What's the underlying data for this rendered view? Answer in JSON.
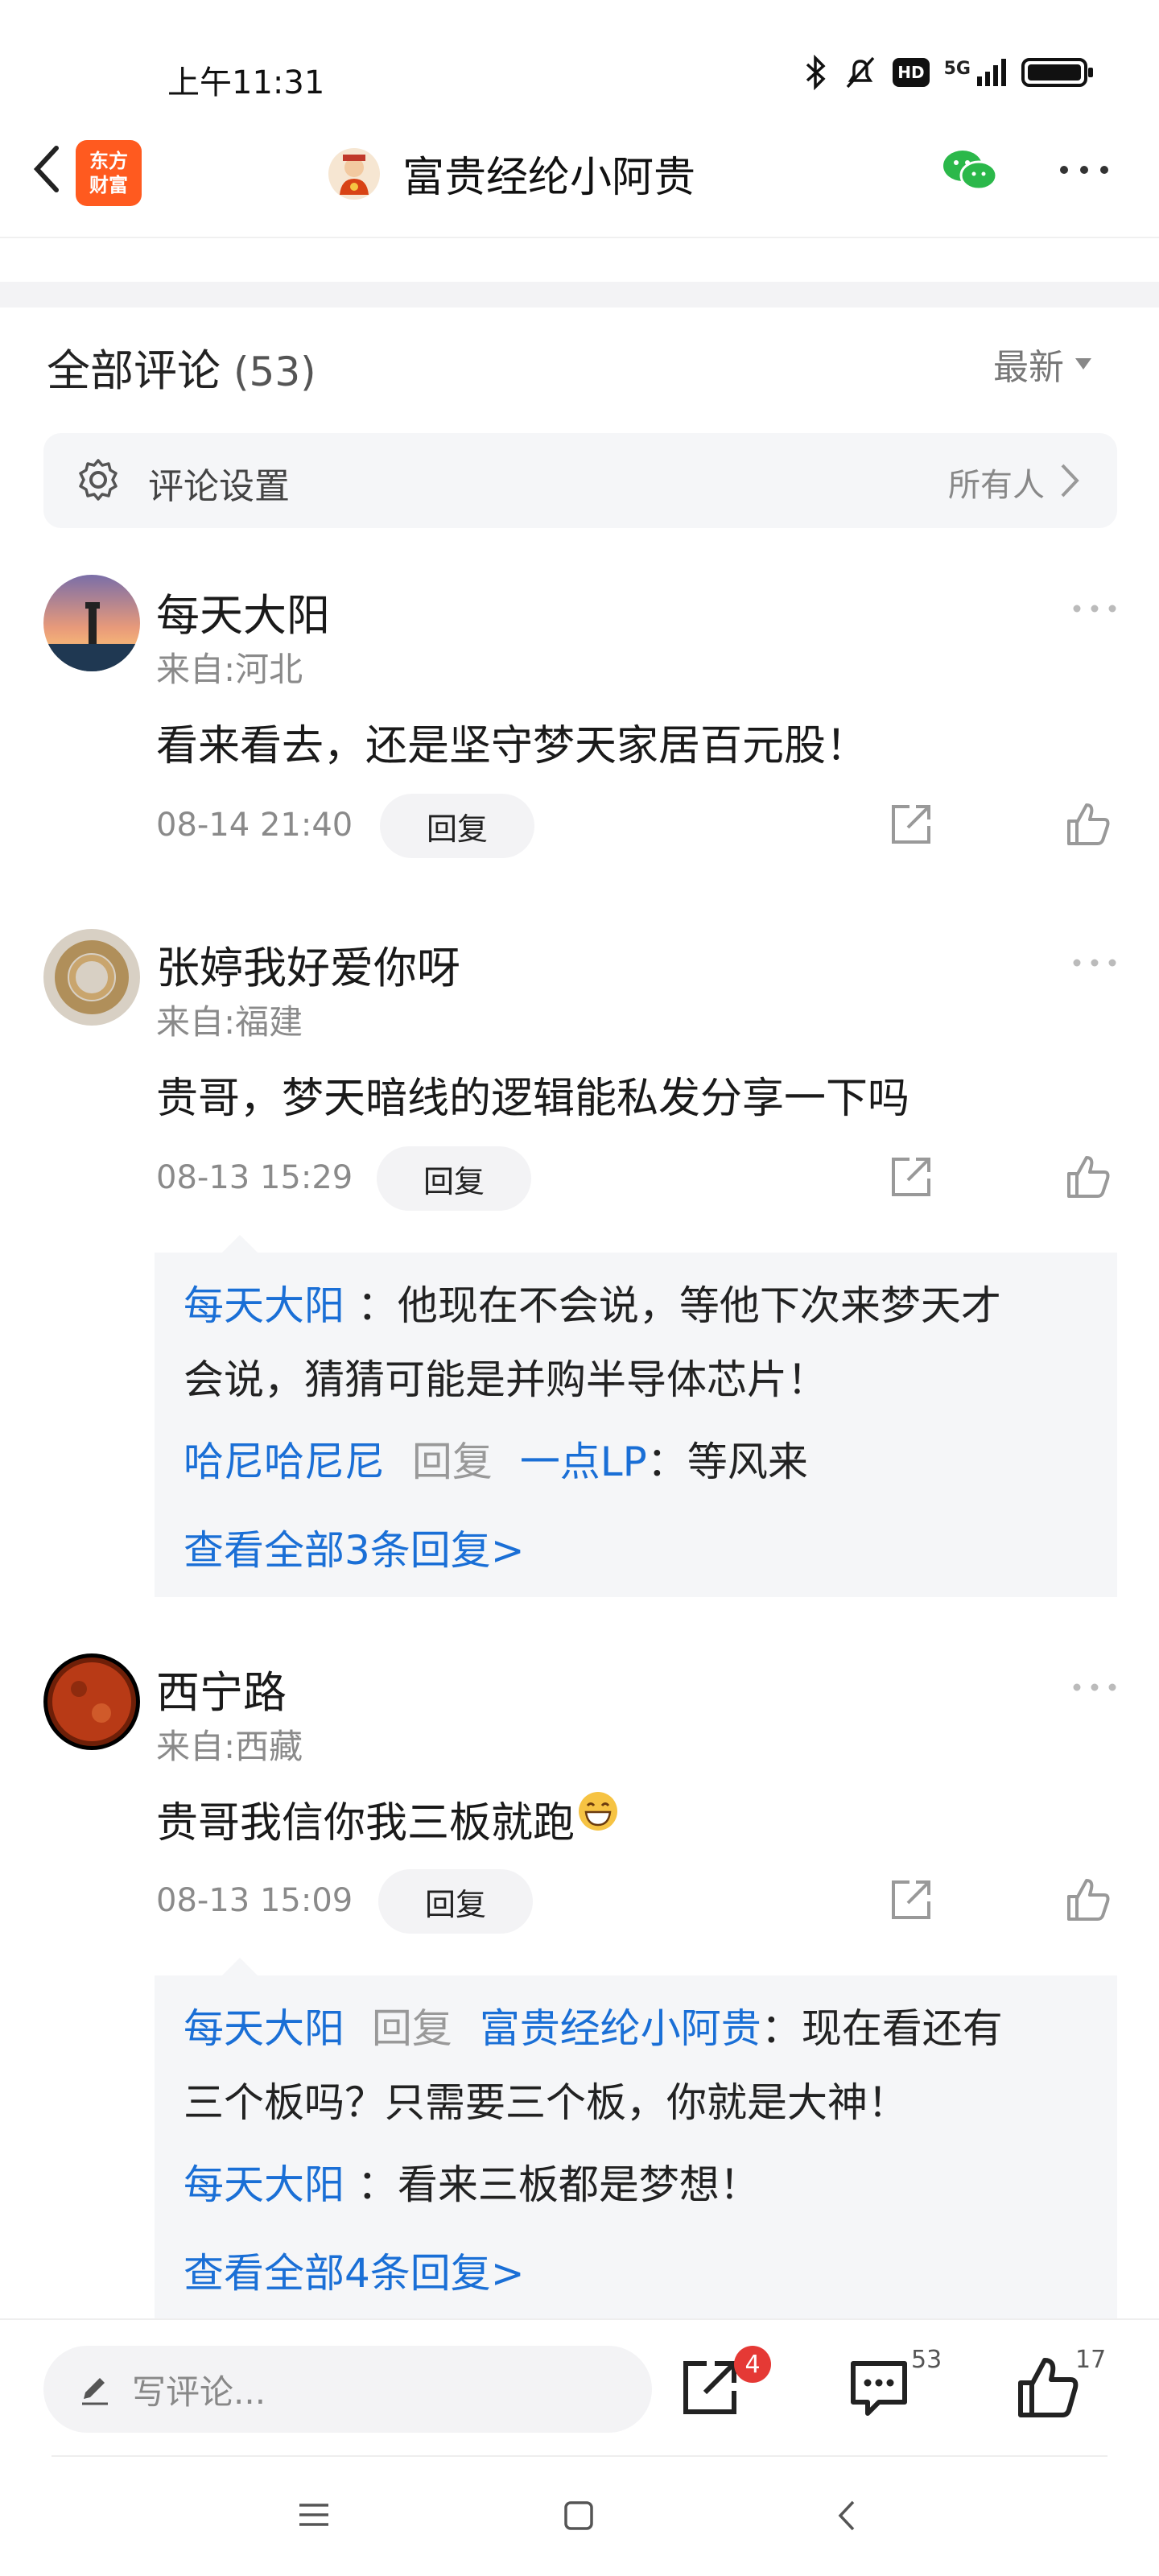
{
  "status": {
    "time": "上午11:31",
    "network": "5G",
    "hd": "HD"
  },
  "nav": {
    "brand_line1": "东方",
    "brand_line2": "财富",
    "title": "富贵经纶小阿贵"
  },
  "comments_header": {
    "title": "全部评论",
    "count": "(53)",
    "sort": "最新"
  },
  "settings": {
    "label": "评论设置",
    "value": "所有人"
  },
  "comments": [
    {
      "name": "每天大阳",
      "location": "来自:河北",
      "text": "看来看去，还是坚守梦天家居百元股！",
      "time": "08-14 21:40",
      "reply_label": "回复"
    },
    {
      "name": "张婷我好爱你呀",
      "location": "来自:福建",
      "text": "贵哥，梦天暗线的逻辑能私发分享一下吗",
      "time": "08-13 15:29",
      "reply_label": "回复",
      "replies": [
        {
          "author": "每天大阳",
          "text_line1": "：他现在不会说，等他下次来梦天才",
          "text_line2": "会说，猜猜可能是并购半导体芯片！"
        },
        {
          "author": "哈尼哈尼尼",
          "verb": "回复",
          "target": "一点LP",
          "text": "：等风来"
        }
      ],
      "more": "查看全部3条回复>"
    },
    {
      "name": "西宁路",
      "location": "来自:西藏",
      "text": "贵哥我信你我三板就跑",
      "time": "08-13 15:09",
      "reply_label": "回复",
      "replies": [
        {
          "author": "每天大阳",
          "verb": "回复",
          "target": "富贵经纶小阿贵",
          "text_line1": "：现在看还有",
          "text_line2": "三个板吗？只需要三个板，你就是大神！"
        },
        {
          "author": "每天大阳",
          "text": "：看来三板都是梦想！"
        }
      ],
      "more": "查看全部4条回复>"
    }
  ],
  "bottom": {
    "write_placeholder": "写评论...",
    "share_badge": "4",
    "comment_count": "53",
    "like_count": "17"
  }
}
